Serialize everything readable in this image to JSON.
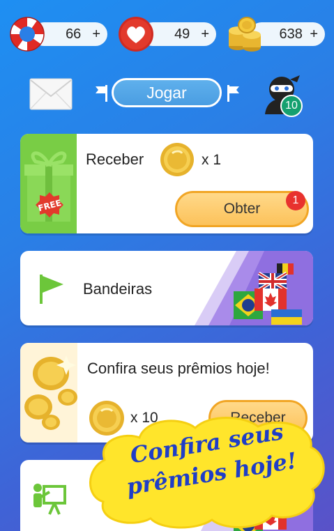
{
  "counters": {
    "lives": {
      "value": "66",
      "plus": "+",
      "icon": "lifebuoy-icon"
    },
    "hearts": {
      "value": "49",
      "plus": "+",
      "icon": "heart-icon"
    },
    "coins": {
      "value": "638",
      "plus": "+",
      "icon": "coin-stack-icon"
    }
  },
  "nav": {
    "mail_icon": "envelope-icon",
    "play_label": "Jogar",
    "profile_icon": "ninja-avatar-icon",
    "profile_badge": "10"
  },
  "gift_card": {
    "title": "Receber",
    "reward_qty": "x 1",
    "button_label": "Obter",
    "button_badge": "1",
    "panel_icon": "gift-free-icon",
    "panel_text": "FREE"
  },
  "flags_card": {
    "title": "Bandeiras",
    "icon": "green-flag-icon",
    "art": "world-flags-art"
  },
  "prizes_card": {
    "title": "Confira seus prêmios hoje!",
    "reward_qty": "x 10",
    "button_label": "Receber",
    "panel_icon": "falling-coins-art"
  },
  "last_card": {
    "icon": "presentation-easel-icon"
  },
  "promo": {
    "text_line1": "Confira seus",
    "text_line2": "prêmios hoje!"
  },
  "colors": {
    "background_top": "#1e8ff2",
    "background_bottom": "#5a52c8",
    "gift_green": "#79cd45",
    "button_orange": "#fcc25a",
    "badge_red": "#e8322e",
    "promo_yellow": "#ffe52b",
    "promo_blue": "#1f3ec7"
  }
}
